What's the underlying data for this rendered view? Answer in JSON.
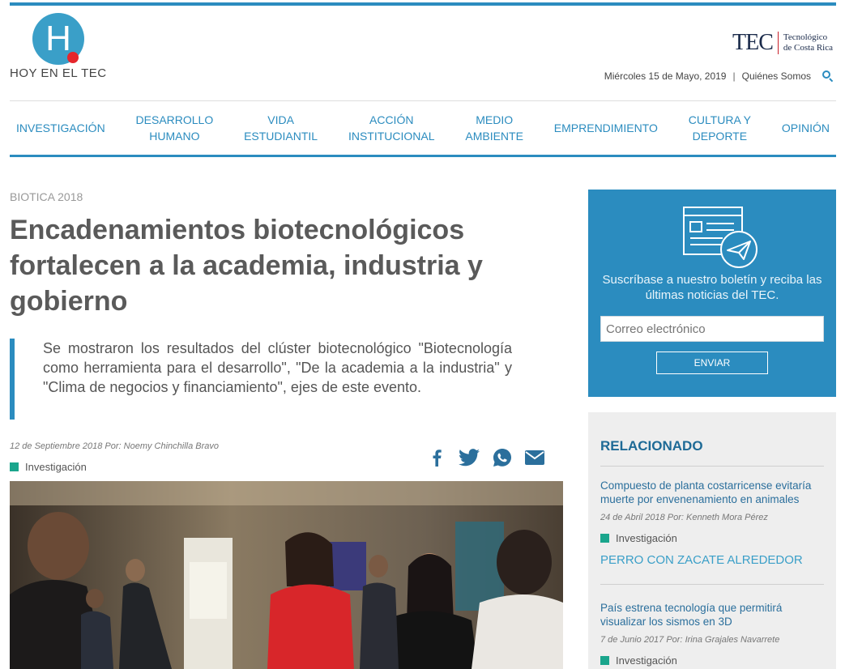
{
  "site": {
    "logo_text": "HOY EN EL TEC",
    "logo_letter": "H",
    "tec_short": "TEC",
    "tec_line1": "Tecnológico",
    "tec_line2": "de Costa Rica",
    "date": "Miércoles 15 de Mayo, 2019",
    "separator": "|",
    "about": "Quiénes Somos"
  },
  "nav": [
    {
      "label": "INVESTIGACIÓN"
    },
    {
      "label": "DESARROLLO\nHUMANO"
    },
    {
      "label": "VIDA\nESTUDIANTIL"
    },
    {
      "label": "ACCIÓN\nINSTITUCIONAL"
    },
    {
      "label": "MEDIO\nAMBIENTE"
    },
    {
      "label": "EMPRENDIMIENTO"
    },
    {
      "label": "CULTURA Y\nDEPORTE"
    },
    {
      "label": "OPINIÓN"
    }
  ],
  "article": {
    "kicker": "BIOTICA 2018",
    "title": "Encadenamientos biotecnológicos fortalecen a la academia, industria y gobierno",
    "lead": "Se mostraron los  resultados del clúster biotecnológico \"Biotecnología como herramienta para el desarrollo\", \"De la academia a la industria\" y \"Clima de negocios y financiamiento\", ejes de este evento.",
    "byline": "12 de Septiembre 2018 Por: Noemy Chinchilla Bravo",
    "category": "Investigación"
  },
  "newsletter": {
    "text": "Suscríbase a nuestro boletín y reciba las últimas noticias del TEC.",
    "placeholder": "Correo electrónico",
    "button": "ENVIAR"
  },
  "related": {
    "title": "RELACIONADO",
    "items": [
      {
        "title": "Compuesto de planta costarricense evitaría muerte por envenenamiento en animales",
        "meta": "24 de Abril 2018 Por: Kenneth Mora Pérez",
        "category": "Investigación",
        "caption": "PERRO CON ZACATE ALREDEDOR"
      },
      {
        "title": "País estrena tecnología que permitirá visualizar los sismos en 3D",
        "meta": "7 de Junio 2017 Por: Irina Grajales Navarrete",
        "category": "Investigación"
      }
    ]
  },
  "colors": {
    "accent": "#2b8cbf",
    "category": "#1aa58c",
    "logo_dot": "#e5262c"
  }
}
